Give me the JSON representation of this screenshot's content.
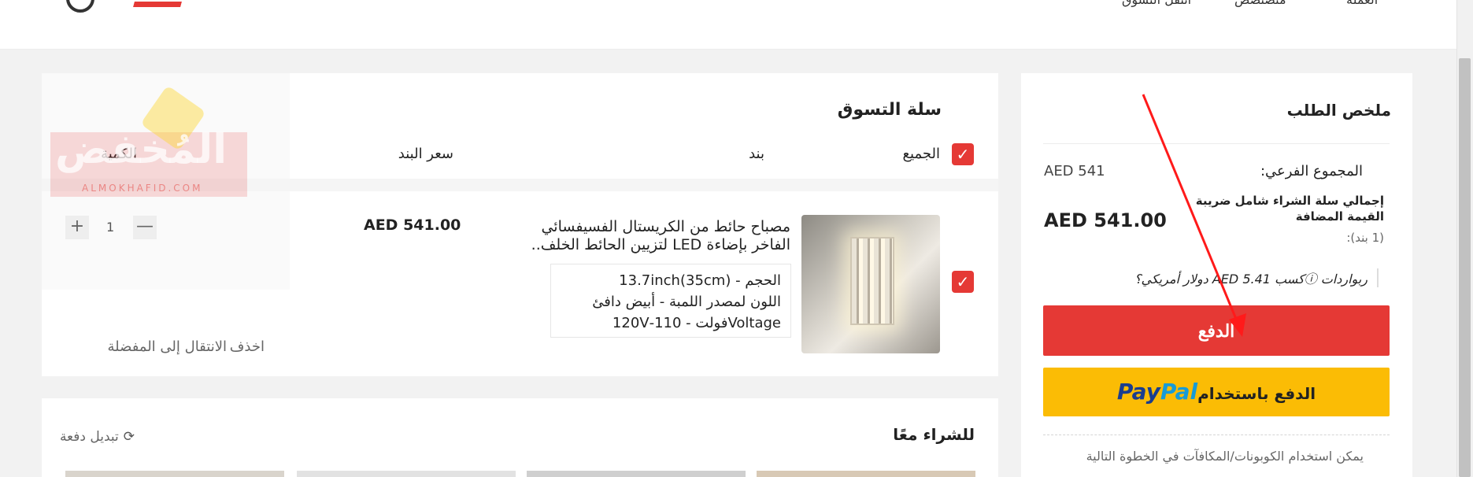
{
  "header": {
    "items": [
      "العملة",
      "منصتصص",
      "انتقل التسوق"
    ]
  },
  "cart": {
    "title": "سلة التسوق",
    "select_all": "الجميع",
    "col_item": "بند",
    "col_price": "سعر البند",
    "col_qty": "الكمية",
    "item": {
      "title_line1": "مصباح حائط من الكريستال الفسيفسائي",
      "title_line2": "الفاخر بإضاءة LED لتزيين الحائط الخلف..",
      "variant_size": "الحجم - 13.7inch(35cm)",
      "variant_color": "اللون لمصدر اللمبة - أبيض دافئ",
      "variant_voltage": "Voltageفولت - 110-120V",
      "price": "AED 541.00",
      "quantity": "1",
      "minus": "—",
      "plus": "+",
      "delete_label": "اخذف",
      "move_to_wishlist": "الانتقال إلى المفضلة"
    }
  },
  "summary": {
    "title": "ملخص الطلب",
    "subtotal_label": "المجموع الفرعي:",
    "subtotal_value": "AED 541",
    "total_label": "إجمالي سلة الشراء شامل ضريبة القيمة المضافة",
    "total_items": "(1 بند):",
    "total_value": "AED 541.00",
    "rewards_text": "ربواردات ⓘكسب AED 5.41 دولار أمريكي؟",
    "pay_button": "الدفع",
    "paypal_label": "الدفع باستخدام",
    "paypal_pay": "Pay",
    "paypal_pal": "Pal",
    "coupon_note": "يمكن استخدام الكوبونات/المكافآت في الخطوة التالية"
  },
  "together": {
    "title": "للشراء معًا",
    "switch_label": "تبديل دفعة"
  },
  "watermark": {
    "text": "المُخفض",
    "sub": "ALMOKHAFID.COM"
  },
  "icons": {
    "check": "✓",
    "refresh": "⟳"
  },
  "colors": {
    "accent": "#e53935",
    "paypal_yellow": "#fbbc05",
    "paypal_blue_dark": "#1a3d8f",
    "paypal_blue_light": "#179bd7"
  }
}
